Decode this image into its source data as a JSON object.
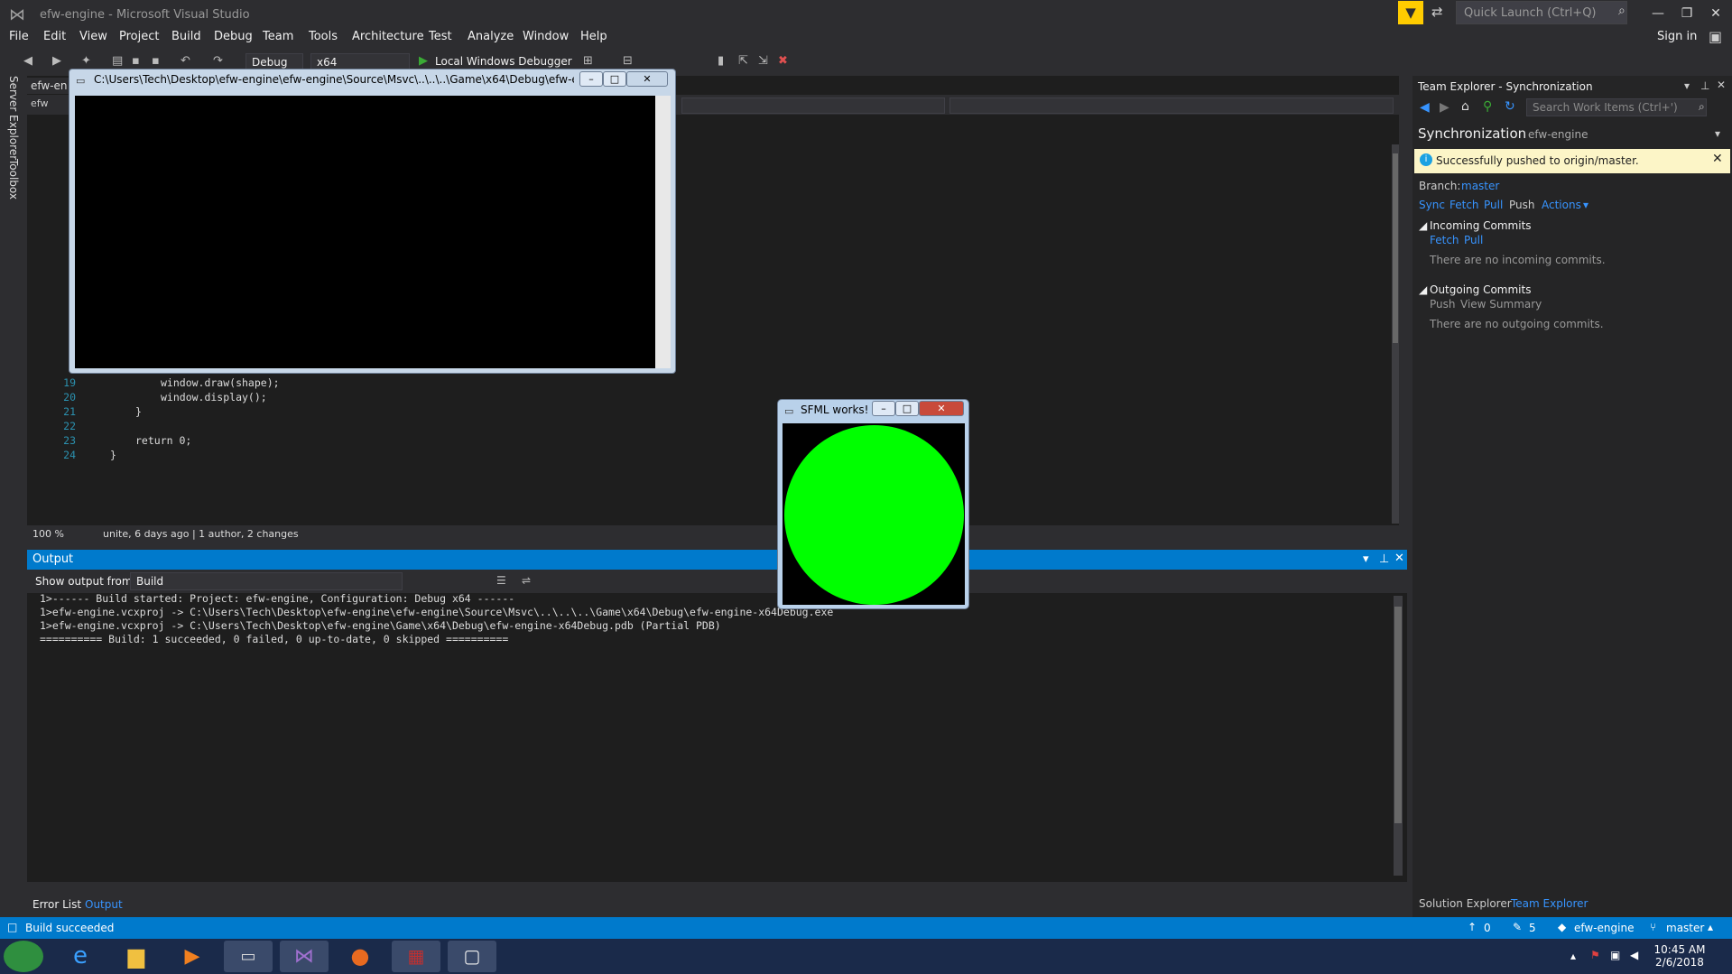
{
  "window": {
    "title": "efw-engine - Microsoft Visual Studio",
    "quick_launch_placeholder": "Quick Launch (Ctrl+Q)",
    "sign_in": "Sign in"
  },
  "menu": [
    "File",
    "Edit",
    "View",
    "Project",
    "Build",
    "Debug",
    "Team",
    "Tools",
    "Architecture",
    "Test",
    "Analyze",
    "Window",
    "Help"
  ],
  "toolbar": {
    "config": "Debug",
    "platform": "x64",
    "debugger": "Local Windows Debugger"
  },
  "left_strip": [
    "Server Explorer",
    "Toolbox"
  ],
  "editor": {
    "tab_label": "efw-en",
    "tab_label2": "efw",
    "lines": [
      {
        "n": "19",
        "text": "window.draw(shape);"
      },
      {
        "n": "20",
        "text": "window.display();"
      },
      {
        "n": "21",
        "text": "}"
      },
      {
        "n": "22",
        "text": ""
      },
      {
        "n": "23",
        "text": "return 0;"
      },
      {
        "n": "24",
        "text": "}"
      }
    ],
    "zoom": "100 %",
    "codelens": "unite, 6 days ago | 1 author, 2 changes"
  },
  "output": {
    "title": "Output",
    "show_from_label": "Show output from:",
    "source": "Build",
    "lines": [
      "1>------ Build started: Project: efw-engine, Configuration: Debug x64 ------",
      "1>efw-engine.vcxproj -> C:\\Users\\Tech\\Desktop\\efw-engine\\efw-engine\\Source\\Msvc\\..\\..\\..\\Game\\x64\\Debug\\efw-engine-x64Debug.exe",
      "1>efw-engine.vcxproj -> C:\\Users\\Tech\\Desktop\\efw-engine\\Game\\x64\\Debug\\efw-engine-x64Debug.pdb (Partial PDB)",
      "========== Build: 1 succeeded, 0 failed, 0 up-to-date, 0 skipped =========="
    ]
  },
  "bottom_tabs": {
    "error_list": "Error List",
    "output": "Output"
  },
  "team_explorer": {
    "header": "Team Explorer - Synchronization",
    "search_placeholder": "Search Work Items (Ctrl+')",
    "title": "Synchronization",
    "repo": "efw-engine",
    "notice": "Successfully pushed to origin/master.",
    "branch_label": "Branch:",
    "branch": "master",
    "actions": {
      "sync": "Sync",
      "fetch": "Fetch",
      "pull": "Pull",
      "push": "Push",
      "actions": "Actions"
    },
    "incoming": {
      "title": "Incoming Commits",
      "fetch": "Fetch",
      "pull": "Pull",
      "empty": "There are no incoming commits."
    },
    "outgoing": {
      "title": "Outgoing Commits",
      "push": "Push",
      "view_summary": "View Summary",
      "empty": "There are no outgoing commits."
    },
    "tabs": {
      "solution": "Solution Explorer",
      "team": "Team Explorer"
    }
  },
  "status": {
    "text": "Build succeeded",
    "up": "0",
    "edits": "5",
    "repo": "efw-engine",
    "branch": "master"
  },
  "console": {
    "title": "C:\\Users\\Tech\\Desktop\\efw-engine\\efw-engine\\Source\\Msvc\\..\\..\\..\\Game\\x64\\Debug\\efw-engine-..."
  },
  "sfml": {
    "title": "SFML works!",
    "circle_color": "#00ff00"
  },
  "tray": {
    "time": "10:45 AM",
    "date": "2/6/2018"
  }
}
